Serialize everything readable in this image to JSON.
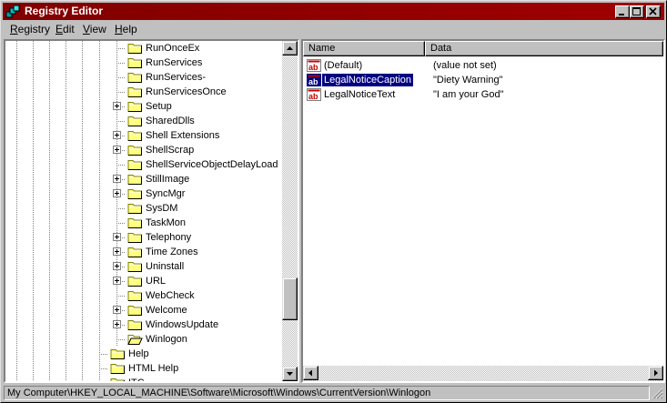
{
  "window": {
    "title": "Registry Editor"
  },
  "menu": [
    {
      "accel": "R",
      "rest": "egistry"
    },
    {
      "accel": "E",
      "rest": "dit"
    },
    {
      "accel": "V",
      "rest": "iew"
    },
    {
      "accel": "H",
      "rest": "elp"
    }
  ],
  "tree": {
    "items": [
      {
        "label": "RunOnceEx",
        "expandable": false,
        "open": false,
        "level": 2
      },
      {
        "label": "RunServices",
        "expandable": false,
        "open": false,
        "level": 2
      },
      {
        "label": "RunServices-",
        "expandable": false,
        "open": false,
        "level": 2
      },
      {
        "label": "RunServicesOnce",
        "expandable": false,
        "open": false,
        "level": 2
      },
      {
        "label": "Setup",
        "expandable": true,
        "open": false,
        "level": 2
      },
      {
        "label": "SharedDlls",
        "expandable": false,
        "open": false,
        "level": 2
      },
      {
        "label": "Shell Extensions",
        "expandable": true,
        "open": false,
        "level": 2
      },
      {
        "label": "ShellScrap",
        "expandable": true,
        "open": false,
        "level": 2
      },
      {
        "label": "ShellServiceObjectDelayLoad",
        "expandable": false,
        "open": false,
        "level": 2
      },
      {
        "label": "StillImage",
        "expandable": true,
        "open": false,
        "level": 2
      },
      {
        "label": "SyncMgr",
        "expandable": true,
        "open": false,
        "level": 2
      },
      {
        "label": "SysDM",
        "expandable": false,
        "open": false,
        "level": 2
      },
      {
        "label": "TaskMon",
        "expandable": false,
        "open": false,
        "level": 2
      },
      {
        "label": "Telephony",
        "expandable": true,
        "open": false,
        "level": 2
      },
      {
        "label": "Time Zones",
        "expandable": true,
        "open": false,
        "level": 2
      },
      {
        "label": "Uninstall",
        "expandable": true,
        "open": false,
        "level": 2
      },
      {
        "label": "URL",
        "expandable": true,
        "open": false,
        "level": 2
      },
      {
        "label": "WebCheck",
        "expandable": false,
        "open": false,
        "level": 2
      },
      {
        "label": "Welcome",
        "expandable": true,
        "open": false,
        "level": 2
      },
      {
        "label": "WindowsUpdate",
        "expandable": true,
        "open": false,
        "level": 2
      },
      {
        "label": "Winlogon",
        "expandable": false,
        "open": true,
        "level": 2
      },
      {
        "label": "Help",
        "expandable": false,
        "open": false,
        "level": 1
      },
      {
        "label": "HTML Help",
        "expandable": false,
        "open": false,
        "level": 1
      },
      {
        "label": "ITC",
        "expandable": false,
        "open": false,
        "level": 1
      }
    ]
  },
  "list": {
    "headers": {
      "name": "Name",
      "data": "Data"
    },
    "rows": [
      {
        "name": "(Default)",
        "data": "(value not set)",
        "selected": false
      },
      {
        "name": "LegalNoticeCaption",
        "data": "\"Diety Warning\"",
        "selected": true
      },
      {
        "name": "LegalNoticeText",
        "data": "\"I am your God\"",
        "selected": false
      }
    ]
  },
  "status": {
    "path": "My Computer\\HKEY_LOCAL_MACHINE\\Software\\Microsoft\\Windows\\CurrentVersion\\Winlogon"
  },
  "icons": {
    "app": "registry-editor-icon",
    "folder": "folder-icon",
    "open_folder": "open-folder-icon",
    "string_value": "string-value-icon"
  },
  "colors": {
    "titlebar": "#800000",
    "selection": "#000080",
    "face": "#c0c0c0"
  }
}
